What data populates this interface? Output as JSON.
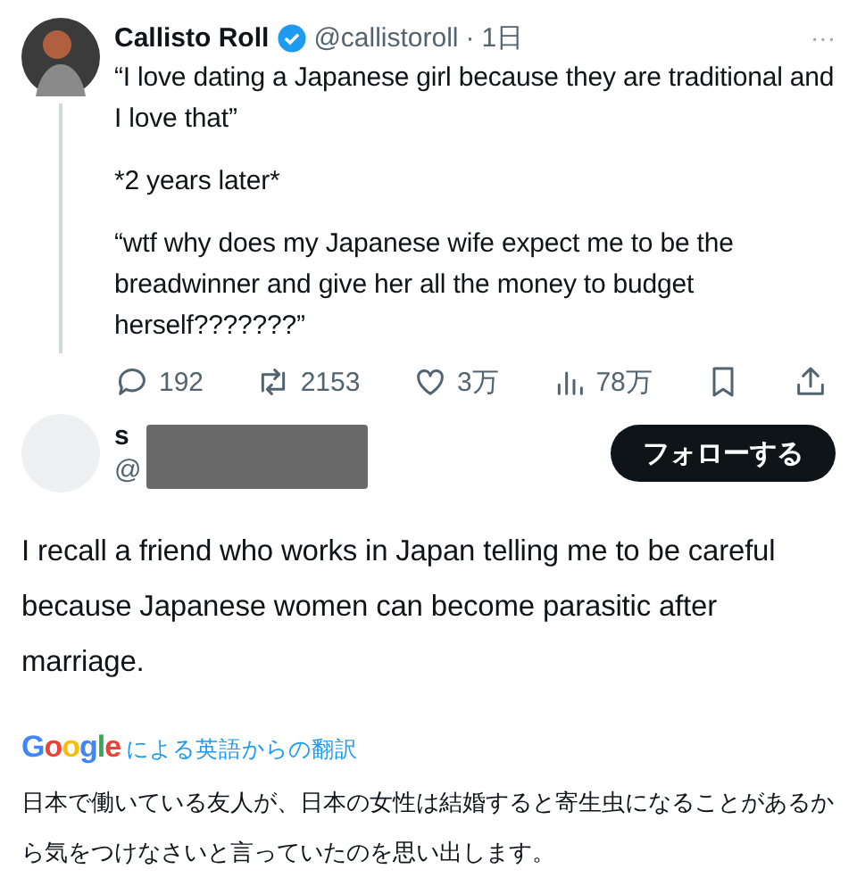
{
  "parent_post": {
    "author": "Callisto Roll",
    "verified": true,
    "handle": "@callistoroll",
    "separator": "·",
    "time": "1日",
    "more": "···",
    "paragraphs": [
      "“I love dating a Japanese girl because they are traditional and I love that”",
      "*2 years later*",
      "“wtf why does my Japanese wife expect me to be the breadwinner and give her all the money to budget herself???????”"
    ],
    "actions": [
      {
        "kind": "reply",
        "count": "192"
      },
      {
        "kind": "repost",
        "count": "2153"
      },
      {
        "kind": "like",
        "count": "3万"
      },
      {
        "kind": "views",
        "count": "78万"
      },
      {
        "kind": "bookmark"
      },
      {
        "kind": "share"
      }
    ]
  },
  "reply_post": {
    "author": "s",
    "handle": "@",
    "redacted": true,
    "follow_button": "フォローする",
    "text": "I recall a friend who works in Japan telling me to be careful because Japanese women can become parasitic after marriage.",
    "translation": {
      "brand": "Google",
      "label": "による英語からの翻訳",
      "text": "日本で働いている友人が、日本の女性は結婚すると寄生虫になることがあるから気をつけなさいと言っていたのを思い出します。"
    }
  }
}
